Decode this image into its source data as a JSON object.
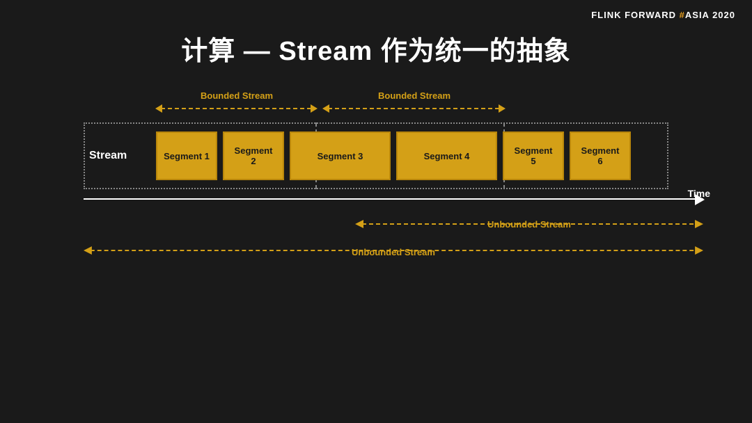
{
  "header": {
    "brand": "FLINK  FORWARD ",
    "hash": "#",
    "conference": "ASIA 2020"
  },
  "title": "计算 — Stream 作为统一的抽象",
  "diagram": {
    "stream_label": "Stream",
    "time_label": "Time",
    "bounded_label_1": "Bounded Stream",
    "bounded_label_2": "Bounded Stream",
    "unbounded_label_1": "Unbounded Stream",
    "unbounded_label_2": "Unbounded Stream",
    "segments": [
      {
        "label": "Segment 1"
      },
      {
        "label": "Segment\n2"
      },
      {
        "label": "Segment 3"
      },
      {
        "label": "Segment 4"
      },
      {
        "label": "Segment\n5"
      },
      {
        "label": "Segment\n6"
      }
    ]
  }
}
